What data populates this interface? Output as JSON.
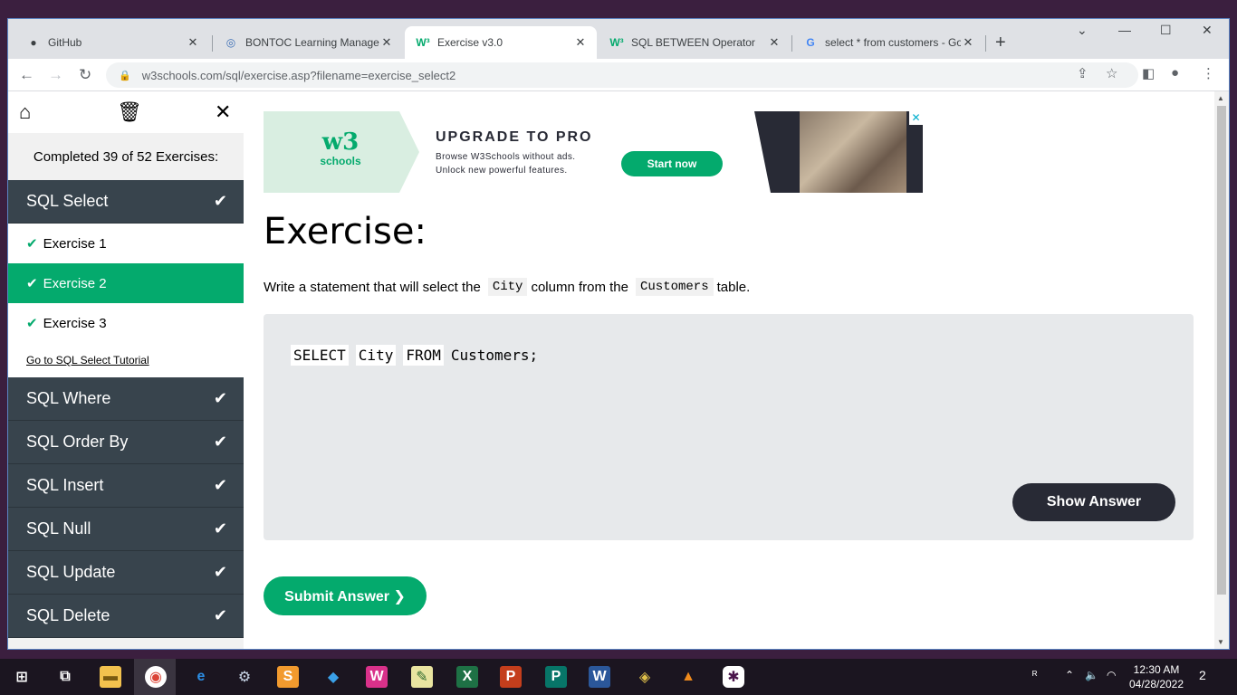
{
  "browser": {
    "tabs": [
      {
        "title": "GitHub",
        "icon": "github-icon"
      },
      {
        "title": "BONTOC Learning Managem",
        "icon": "lms-icon"
      },
      {
        "title": "Exercise v3.0",
        "icon": "w3schools-icon",
        "active": true
      },
      {
        "title": "SQL BETWEEN Operator",
        "icon": "w3schools-icon"
      },
      {
        "title": "select * from customers - Go",
        "icon": "google-icon"
      }
    ],
    "tab_close": "✕",
    "new_tab": "+",
    "url": "w3schools.com/sql/exercise.asp?filename=exercise_select2"
  },
  "sidebar": {
    "completed_text": "Completed 39 of 52 Exercises:",
    "sections": [
      {
        "label": "SQL Select",
        "expanded": true
      },
      {
        "label": "SQL Where"
      },
      {
        "label": "SQL Order By"
      },
      {
        "label": "SQL Insert"
      },
      {
        "label": "SQL Null"
      },
      {
        "label": "SQL Update"
      },
      {
        "label": "SQL Delete"
      }
    ],
    "exercises": [
      "Exercise 1",
      "Exercise 2",
      "Exercise 3"
    ],
    "active_exercise": "Exercise 2",
    "goto_link": "Go to SQL Select Tutorial"
  },
  "ad": {
    "logo_w3": "w3",
    "logo_schools": "schools",
    "title": "UPGRADE TO PRO",
    "line1": "Browse W3Schools without ads.",
    "line2": "Unlock new powerful features.",
    "button": "Start now"
  },
  "exercise": {
    "heading": "Exercise:",
    "desc_prefix": "Write a statement that will select the",
    "desc_code1": "City",
    "desc_middle": "column from the",
    "desc_code2": "Customers",
    "desc_suffix": "table.",
    "sql_keyword1": "SELECT",
    "sql_input": "City",
    "sql_keyword2": "FROM",
    "sql_rest": "Customers;",
    "show_answer": "Show Answer",
    "submit": "Submit Answer ❯"
  },
  "taskbar": {
    "time": "12:30 AM",
    "date": "04/28/2022",
    "notifications": "2"
  },
  "colors": {
    "accent": "#04aa6d",
    "sidebar_section": "#38444d",
    "dark_button": "#282a35"
  }
}
